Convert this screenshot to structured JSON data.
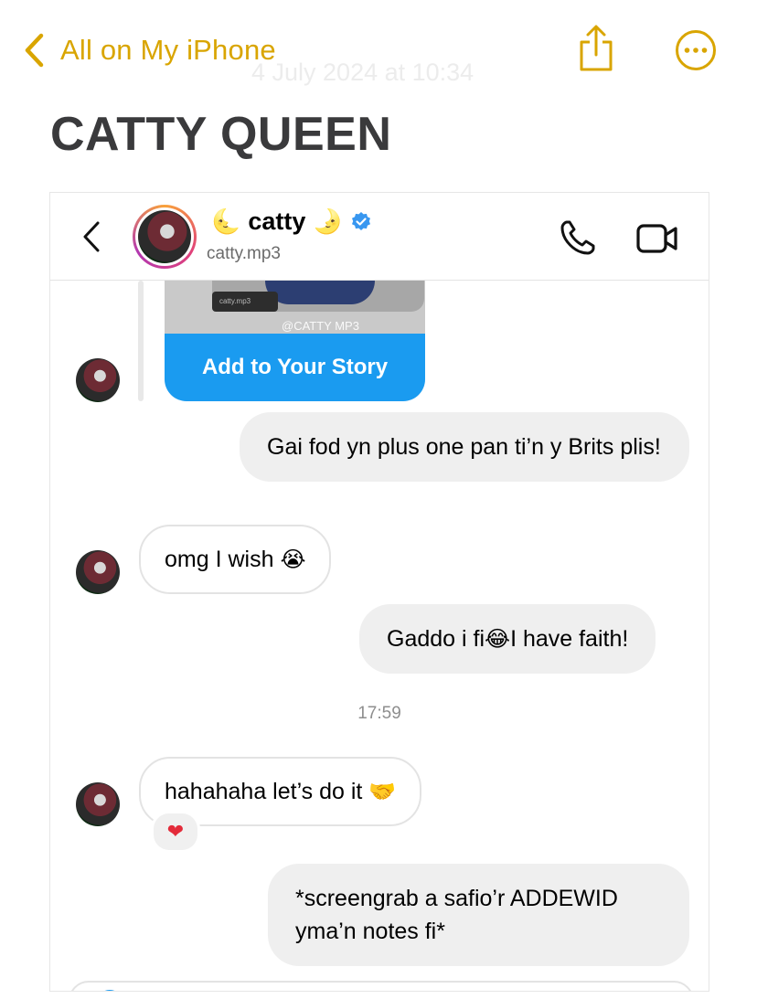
{
  "notes": {
    "back_label": "All on My iPhone",
    "date": "4 July 2024 at 10:34",
    "title": "CATTY QUEEN",
    "accent_color": "#D9A500",
    "icons": {
      "back": "chevron-left-icon",
      "share": "share-icon",
      "more": "ellipsis-circle-icon"
    }
  },
  "chat": {
    "contact": {
      "name": "catty",
      "moon_left": "🌜",
      "moon_right": "🌛",
      "handle": "catty.mp3",
      "verified": true
    },
    "story": {
      "tag_text": "catty.mp3",
      "watermark": "@CATTY MP3",
      "button_label": "Add to Your Story"
    },
    "messages": [
      {
        "side": "out",
        "text": "Gai fod yn plus one pan ti’n y Brits plis!"
      },
      {
        "side": "in",
        "text": "omg I wish",
        "emoji": "😭"
      },
      {
        "side": "out",
        "text_before": "Gaddo i fi",
        "emoji": "😂",
        "text_after": "I have faith!"
      },
      {
        "side": "in",
        "text": "hahahaha let’s do it",
        "emoji": "🤝",
        "reaction": "❤"
      },
      {
        "side": "out",
        "text": "*screengrab a safio’r ADDEWID yma’n notes fi*"
      }
    ],
    "timestamp": "17:59",
    "accent_color": "#1A9BF0",
    "icons": {
      "back": "chevron-left-icon",
      "call": "phone-icon",
      "video": "video-camera-icon",
      "verified": "verified-badge-icon"
    }
  }
}
